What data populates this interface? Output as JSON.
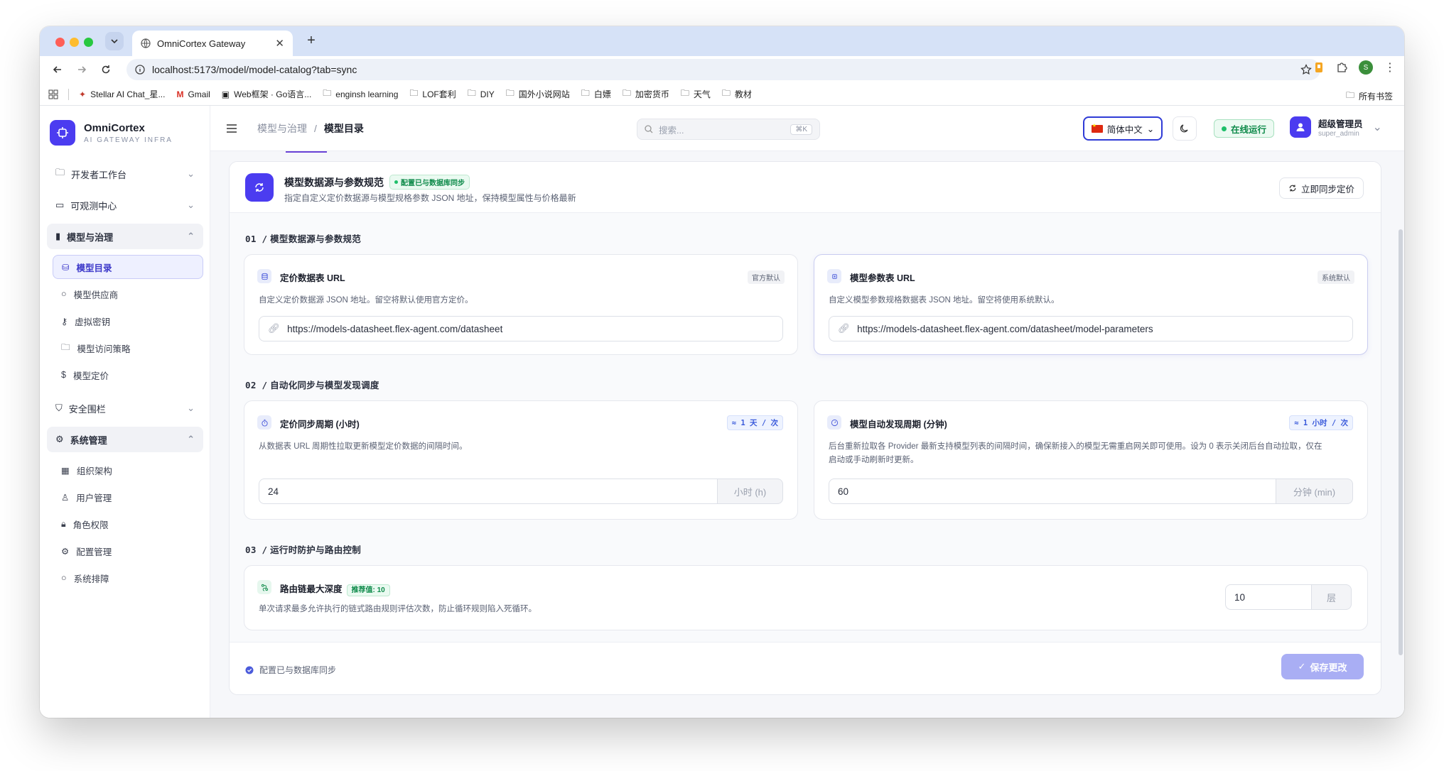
{
  "browser": {
    "tab_title": "OmniCortex Gateway",
    "url": "localhost:5173/model/model-catalog?tab=sync",
    "profile_initial": "S",
    "bookmarks": [
      "Stellar AI Chat_星...",
      "Gmail",
      "Web框架 · Go语言...",
      "enginsh learning",
      "LOF套利",
      "DIY",
      "国外小说网站",
      "白嫖",
      "加密货币",
      "天气",
      "教材"
    ],
    "all_bookmarks": "所有书签"
  },
  "brand": {
    "name": "OmniCortex",
    "tagline": "AI GATEWAY INFRA"
  },
  "sidebar": {
    "groups": [
      {
        "label": "开发者工作台",
        "icon": "folder-icon"
      },
      {
        "label": "可观测中心",
        "icon": "monitor-icon"
      },
      {
        "label": "模型与治理",
        "icon": "chart-icon"
      },
      {
        "label": "安全围栏",
        "icon": "shield-icon"
      },
      {
        "label": "系统管理",
        "icon": "gear-icon"
      }
    ],
    "model_items": [
      "模型目录",
      "模型供应商",
      "虚拟密钥",
      "模型访问策略",
      "模型定价"
    ],
    "system_items": [
      "组织架构",
      "用户管理",
      "角色权限",
      "配置管理",
      "系统排障"
    ]
  },
  "header": {
    "crumb_parent": "模型与治理",
    "crumb_sep": "/",
    "crumb_current": "模型目录",
    "search_placeholder": "搜索...",
    "search_kbd": "⌘K",
    "language": "简体中文",
    "status": "在线运行",
    "user_name": "超级管理员",
    "user_id": "super_admin"
  },
  "panel": {
    "title": "模型数据源与参数规范",
    "sync_badge": "配置已与数据库同步",
    "desc": "指定自定义定价数据源与模型规格参数 JSON 地址，保持模型属性与价格最新",
    "sync_button": "立即同步定价",
    "section1": {
      "num": "01 /",
      "title": "模型数据源与参数规范"
    },
    "pricing_url": {
      "title": "定价数据表 URL",
      "tag": "官方默认",
      "desc": "自定义定价数据源 JSON 地址。留空将默认使用官方定价。",
      "value": "https://models-datasheet.flex-agent.com/datasheet"
    },
    "params_url": {
      "title": "模型参数表 URL",
      "tag": "系统默认",
      "desc": "自定义模型参数规格数据表 JSON 地址。留空将使用系统默认。",
      "value": "https://models-datasheet.flex-agent.com/datasheet/model-parameters"
    },
    "section2": {
      "num": "02 /",
      "title": "自动化同步与模型发现调度"
    },
    "sync_period": {
      "title": "定价同步周期 (小时)",
      "tag": "≈ 1 天 / 次",
      "desc": "从数据表 URL 周期性拉取更新模型定价数据的间隔时间。",
      "value": "24",
      "unit": "小时 (h)"
    },
    "discover_period": {
      "title": "模型自动发现周期 (分钟)",
      "tag": "≈ 1 小时 / 次",
      "desc_line1": "后台重新拉取各 Provider 最新支持模型列表的间隔时间，确保新接入的模型无需重启网关即可使用。设为 0 表示关闭后台自动拉取，仅在",
      "desc_line2": "启动或手动刷新时更新。",
      "value": "60",
      "unit": "分钟 (min)"
    },
    "section3": {
      "num": "03 /",
      "title": "运行时防护与路由控制"
    },
    "route_depth": {
      "title": "路由链最大深度",
      "recommend": "推荐值: 10",
      "desc": "单次请求最多允许执行的链式路由规则评估次数，防止循环规则陷入死循环。",
      "value": "10",
      "unit": "层"
    },
    "footer_status": "配置已与数据库同步",
    "save_button": "保存更改"
  }
}
